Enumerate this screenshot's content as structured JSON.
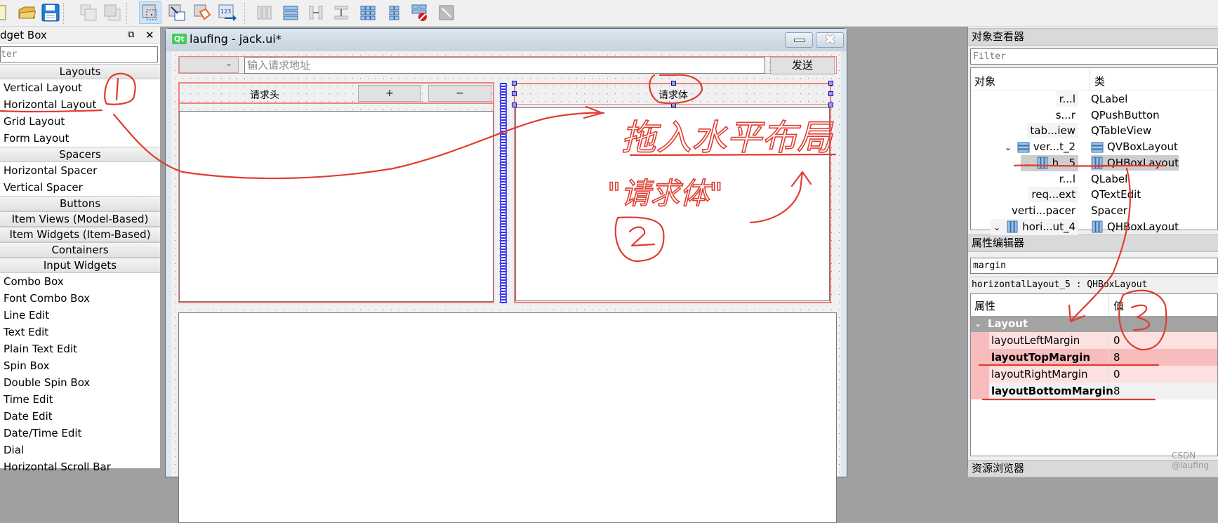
{
  "toolbar": {
    "buttons": [
      {
        "name": "new-file-icon"
      },
      {
        "name": "open-folder-icon"
      },
      {
        "name": "save-icon"
      },
      {
        "name": "send-to-back-icon"
      },
      {
        "name": "bring-to-front-icon"
      },
      {
        "name": "edit-widgets-icon",
        "active": true
      },
      {
        "name": "edit-signals-slots-icon"
      },
      {
        "name": "edit-buddies-icon"
      },
      {
        "name": "edit-tab-order-icon"
      },
      {
        "name": "lay-out-horizontally-icon"
      },
      {
        "name": "lay-out-vertically-icon"
      },
      {
        "name": "lay-out-horizontal-splitter-icon"
      },
      {
        "name": "lay-out-vertical-splitter-icon"
      },
      {
        "name": "lay-out-grid-icon"
      },
      {
        "name": "lay-out-form-icon"
      },
      {
        "name": "break-layout-icon"
      },
      {
        "name": "adjust-size-icon"
      }
    ]
  },
  "widget_box": {
    "title": "dget Box",
    "filter_placeholder": "ter",
    "sections": [
      {
        "header": "Layouts",
        "items": [
          "Vertical Layout",
          "Horizontal Layout",
          "Grid Layout",
          "Form Layout"
        ]
      },
      {
        "header": "Spacers",
        "items": [
          "Horizontal Spacer",
          "Vertical Spacer"
        ]
      },
      {
        "header": "Buttons",
        "items": []
      },
      {
        "header": "Item Views (Model-Based)",
        "items": []
      },
      {
        "header": "Item Widgets (Item-Based)",
        "items": []
      },
      {
        "header": "Containers",
        "items": []
      },
      {
        "header": "Input Widgets",
        "items": [
          "Combo Box",
          "Font Combo Box",
          "Line Edit",
          "Text Edit",
          "Plain Text Edit",
          "Spin Box",
          "Double Spin Box",
          "Time Edit",
          "Date Edit",
          "Date/Time Edit",
          "Dial",
          "Horizontal Scroll Bar"
        ]
      }
    ]
  },
  "form": {
    "app_badge": "Qt",
    "title": "laufing - jack.ui*",
    "url_placeholder": "输入请求地址",
    "send_label": "发送",
    "headers_label": "请求头",
    "add_label": "+",
    "remove_label": "−",
    "body_label": "请求体"
  },
  "object_inspector": {
    "title": "对象查看器",
    "filter_placeholder": "Filter",
    "columns": [
      "对象",
      "类"
    ],
    "rows": [
      {
        "name": "r...l",
        "class": "QLabel",
        "indent": 0,
        "icon": null,
        "alt": true
      },
      {
        "name": "s...r",
        "class": "QPushButton",
        "indent": 0,
        "icon": null,
        "alt": false
      },
      {
        "name": "tab...iew",
        "class": "QTableView",
        "indent": 0,
        "icon": null,
        "alt": true
      },
      {
        "name": "ver...t_2",
        "class": "QVBoxLayout",
        "indent": 0,
        "icon": "vbox",
        "expanded": true,
        "alt": false
      },
      {
        "name": "h...5",
        "class": "QHBoxLayout",
        "indent": 0,
        "icon": "hbox",
        "expanded": true,
        "selected": true
      },
      {
        "name": "r...l",
        "class": "QLabel",
        "indent": 0,
        "icon": null,
        "alt": false
      },
      {
        "name": "req...ext",
        "class": "QTextEdit",
        "indent": 0,
        "icon": null,
        "alt": true
      },
      {
        "name": "verti...pacer",
        "class": "Spacer",
        "indent": 0,
        "icon": null,
        "alt": false
      },
      {
        "name": "hori...ut_4",
        "class": "QHBoxLayout",
        "indent": 0,
        "icon": "hbox",
        "expanded": true,
        "alt": true
      }
    ]
  },
  "property_editor": {
    "title": "属性编辑器",
    "filter_value": "margin",
    "object_label": "horizontalLayout_5 : QHBoxLayout",
    "columns": [
      "属性",
      "值"
    ],
    "group": "Layout",
    "properties": [
      {
        "name": "layoutLeftMargin",
        "value": "0",
        "bold": false
      },
      {
        "name": "layoutTopMargin",
        "value": "8",
        "bold": true
      },
      {
        "name": "layoutRightMargin",
        "value": "0",
        "bold": false
      },
      {
        "name": "layoutBottomMargin",
        "value": "8",
        "bold": true
      }
    ]
  },
  "resource_browser": {
    "title": "资源浏览器"
  },
  "watermark": "CSDN @laufing",
  "annotations": {
    "step1": "①",
    "step2": "②",
    "step3": "③",
    "note_drag": "拖入水平布局",
    "note_body": "\"请求体\""
  },
  "colors": {
    "annotation": "#e03c31",
    "layout_frame": "#f08080",
    "selection_handle": "#0000d0"
  }
}
